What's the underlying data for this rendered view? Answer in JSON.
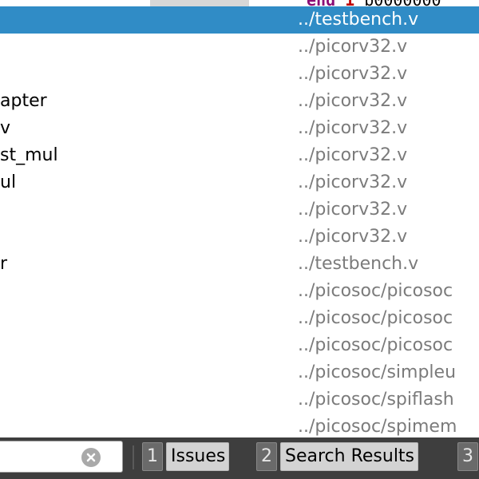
{
  "editor_fragment": {
    "code_keyword": "end",
    "code_literal": "1",
    "code_rest": "'b0000000"
  },
  "locator": {
    "rows": [
      {
        "name": "",
        "path": "../testbench.v",
        "selected": true
      },
      {
        "name": "",
        "path": "../picorv32.v"
      },
      {
        "name": "",
        "path": "../picorv32.v"
      },
      {
        "name": "apter",
        "path": "../picorv32.v"
      },
      {
        "name": "v",
        "path": "../picorv32.v"
      },
      {
        "name": "st_mul",
        "path": "../picorv32.v"
      },
      {
        "name": "ul",
        "path": "../picorv32.v"
      },
      {
        "name": "",
        "path": "../picorv32.v"
      },
      {
        "name": "",
        "path": "../picorv32.v"
      },
      {
        "name": "r",
        "path": "../testbench.v"
      },
      {
        "name": "",
        "path": "../picosoc/picosoc"
      },
      {
        "name": "",
        "path": "../picosoc/picosoc"
      },
      {
        "name": "",
        "path": "../picosoc/picosoc"
      },
      {
        "name": "",
        "path": "../picosoc/simpleu"
      },
      {
        "name": "",
        "path": "../picosoc/spiflash"
      },
      {
        "name": "",
        "path": "../picosoc/spimem"
      }
    ]
  },
  "statusbar": {
    "filter_value": "",
    "panes": [
      {
        "num": "1",
        "label": "Issues"
      },
      {
        "num": "2",
        "label": "Search Results"
      },
      {
        "num": "3",
        "label": ""
      }
    ]
  },
  "colors": {
    "selection": "#308cc6",
    "statusbar_bg": "#3e3e3e",
    "path_text": "#7b7b7b"
  }
}
